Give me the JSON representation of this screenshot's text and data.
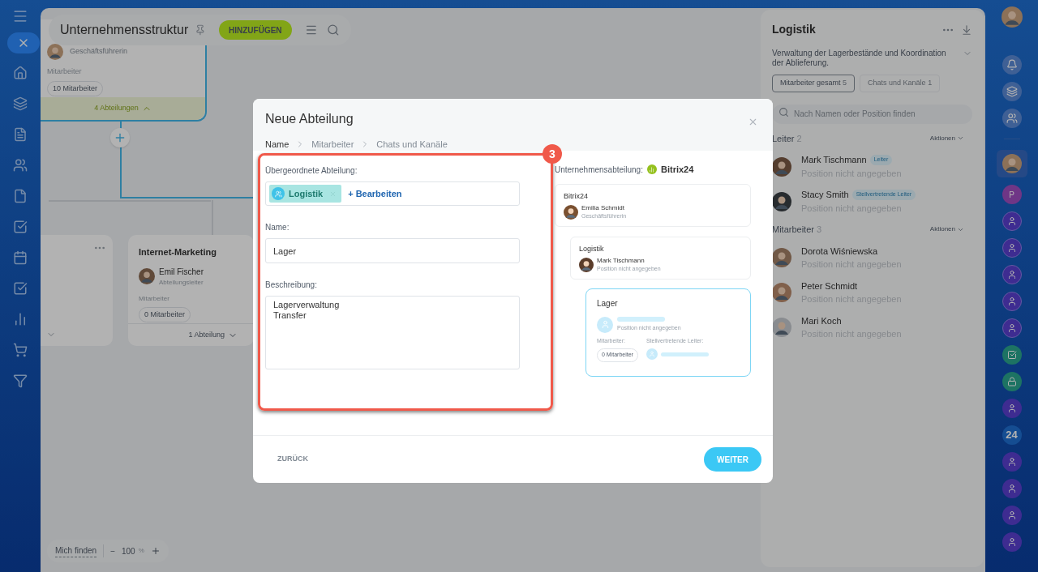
{
  "header": {
    "title": "Unternehmensstruktur",
    "add_button": "HINZUFÜGEN"
  },
  "top_card": {
    "role": "Geschäftsführerin",
    "staff_label": "Mitarbeiter",
    "staff_count": "10 Mitarbeiter",
    "sub_departments": "4 Abteilungen"
  },
  "dept_card": {
    "title": "Internet-Marketing",
    "head": "Emil Fischer",
    "role": "Abteilungsleiter",
    "staff_label": "Mitarbeiter",
    "staff_count": "0 Mitarbeiter",
    "sub_departments": "1 Abteilung"
  },
  "zoom_bar": {
    "find": "Mich finden",
    "minus": "−",
    "zoom": "100",
    "unit": "%"
  },
  "modal": {
    "title": "Neue Abteilung",
    "steps": [
      {
        "label": "Name",
        "selected": true
      },
      {
        "label": "Mitarbeiter",
        "selected": false
      },
      {
        "label": "Chats und Kanäle",
        "selected": false
      }
    ],
    "annotation": "3",
    "parent_label": "Übergeordnete Abteilung:",
    "parent_chip": "Logistik",
    "edit_link": "+ Bearbeiten",
    "name_label": "Name:",
    "name_value": "Lager",
    "description_label": "Beschreibung:",
    "description_value": "Lagerverwaltung\nTransfer",
    "preview": {
      "label": "Unternehmensabteilung:",
      "company": "Bitrix24",
      "nodes": [
        {
          "title": "Bitrix24",
          "person": "Emilia Schmidt",
          "role": "Geschäftsführerin"
        },
        {
          "title": "Logistik",
          "person": "Mark Tischmann",
          "role": "Position nicht angegeben"
        }
      ],
      "new_node": {
        "title": "Lager",
        "role": "Position nicht angegeben",
        "staff_label": "Mitarbeiter:",
        "staff_count": "0 Mitarbeiter",
        "deputy_label": "Stellvertretende Leiter:"
      }
    },
    "back_button": "ZURÜCK",
    "next_button": "WEITER"
  },
  "side_panel": {
    "title": "Logistik",
    "description": "Verwaltung der Lagerbestände und Koordination der Ablieferung.",
    "tabs": [
      {
        "label": "Mitarbeiter gesamt",
        "count": "5",
        "selected": true
      },
      {
        "label": "Chats und Kanäle",
        "count": "1",
        "selected": false
      }
    ],
    "search_placeholder": "Nach Namen oder Position finden",
    "sections": [
      {
        "title": "Leiter",
        "count": "2",
        "action": "Aktionen",
        "members": [
          {
            "name": "Mark Tischmann",
            "badge": "Leiter",
            "position": "Position nicht angegeben"
          },
          {
            "name": "Stacy Smith",
            "badge": "Stellvertretende Leiter",
            "position": "Position nicht angegeben"
          }
        ]
      },
      {
        "title": "Mitarbeiter",
        "count": "3",
        "action": "Aktionen",
        "members": [
          {
            "name": "Dorota Wiśniewska",
            "position": "Position nicht angegeben"
          },
          {
            "name": "Peter Schmidt",
            "position": "Position nicht angegeben"
          },
          {
            "name": "Mari Koch",
            "position": "Position nicht angegeben"
          }
        ]
      }
    ]
  },
  "right_bar": {
    "letter_avatar": "P",
    "logo_text": "24"
  }
}
